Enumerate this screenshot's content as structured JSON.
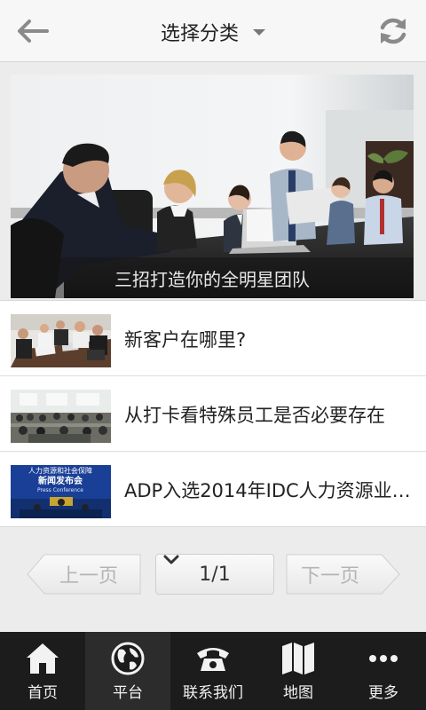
{
  "header": {
    "title": "选择分类",
    "back_icon": "back-arrow-icon",
    "refresh_icon": "refresh-icon"
  },
  "banner": {
    "caption": "三招打造你的全明星团队"
  },
  "news": [
    {
      "title": "新客户在哪里?"
    },
    {
      "title": "从打卡看特殊员工是否必要存在"
    },
    {
      "title": "ADP入选2014年IDC人力资源业…"
    }
  ],
  "news_thumb_text": {
    "line1": "人力资源和社会保障",
    "line2": "新闻发布会",
    "line3": "Press Conference"
  },
  "pager": {
    "prev": "上一页",
    "current": "1/1",
    "next": "下一页"
  },
  "tabs": [
    {
      "label": "首页",
      "icon": "home-icon"
    },
    {
      "label": "平台",
      "icon": "globe-icon"
    },
    {
      "label": "联系我们",
      "icon": "phone-icon"
    },
    {
      "label": "地图",
      "icon": "map-icon"
    },
    {
      "label": "更多",
      "icon": "more-dots-icon"
    }
  ],
  "colors": {
    "tabbar": "#1c1c1c",
    "tab_active": "#2c2c2c",
    "page_bg": "#ececec"
  }
}
